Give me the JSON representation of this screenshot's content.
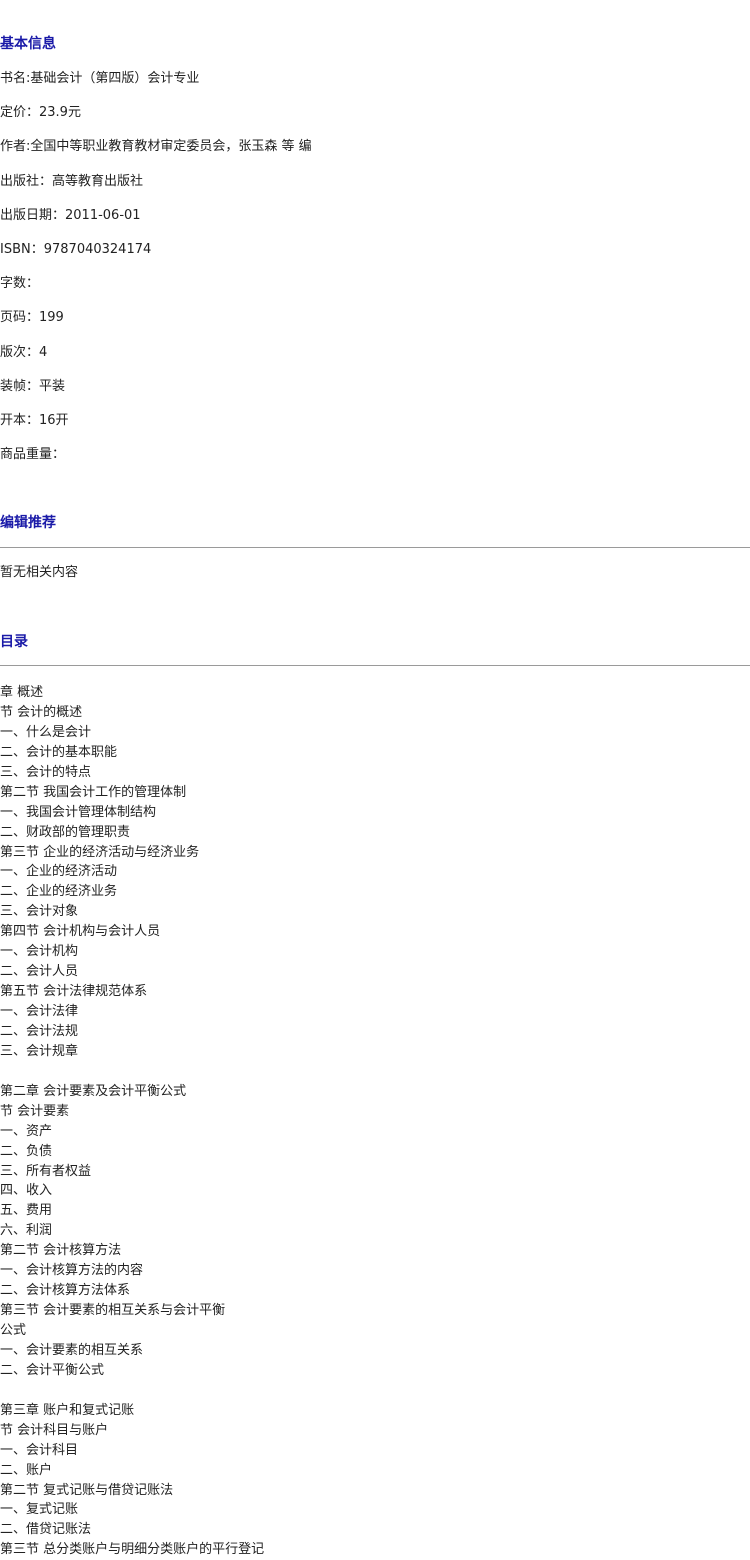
{
  "basic_info": {
    "heading": "基本信息",
    "rows": [
      "书名:基础会计（第四版）会计专业",
      "定价：23.9元",
      "作者:全国中等职业教育教材审定委员会，张玉森 等 编",
      "出版社：高等教育出版社",
      "出版日期：2011-06-01",
      "ISBN：9787040324174",
      "字数：",
      "页码：199",
      "版次：4",
      "装帧：平装",
      "开本：16开",
      "商品重量："
    ]
  },
  "editor_recommendation": {
    "heading": "编辑推荐",
    "content": "暂无相关内容"
  },
  "toc": {
    "heading": "目录",
    "items": [
      "章 概述",
      "节 会计的概述",
      "一、什么是会计",
      "二、会计的基本职能",
      "三、会计的特点",
      "第二节 我国会计工作的管理体制",
      "一、我国会计管理体制结构",
      "二、财政部的管理职责",
      "第三节 企业的经济活动与经济业务",
      "一、企业的经济活动",
      "二、企业的经济业务",
      "三、会计对象",
      "第四节 会计机构与会计人员",
      "一、会计机构",
      "二、会计人员",
      "第五节 会计法律规范体系",
      "一、会计法律",
      "二、会计法规",
      "三、会计规章",
      "",
      "第二章 会计要素及会计平衡公式",
      "节 会计要素",
      "一、资产",
      "二、负债",
      "三、所有者权益",
      "四、收入",
      "五、费用",
      "六、利润",
      "第二节 会计核算方法",
      "一、会计核算方法的内容",
      "二、会计核算方法体系",
      "第三节 会计要素的相互关系与会计平衡",
      "公式",
      "一、会计要素的相互关系",
      "二、会计平衡公式",
      "",
      "第三章 账户和复式记账",
      "节 会计科目与账户",
      "一、会计科目",
      "二、账户",
      "第二节 复式记账与借贷记账法",
      "一、复式记账",
      "二、借贷记账法",
      "第三节 总分类账户与明细分类账户的平行登记"
    ]
  }
}
